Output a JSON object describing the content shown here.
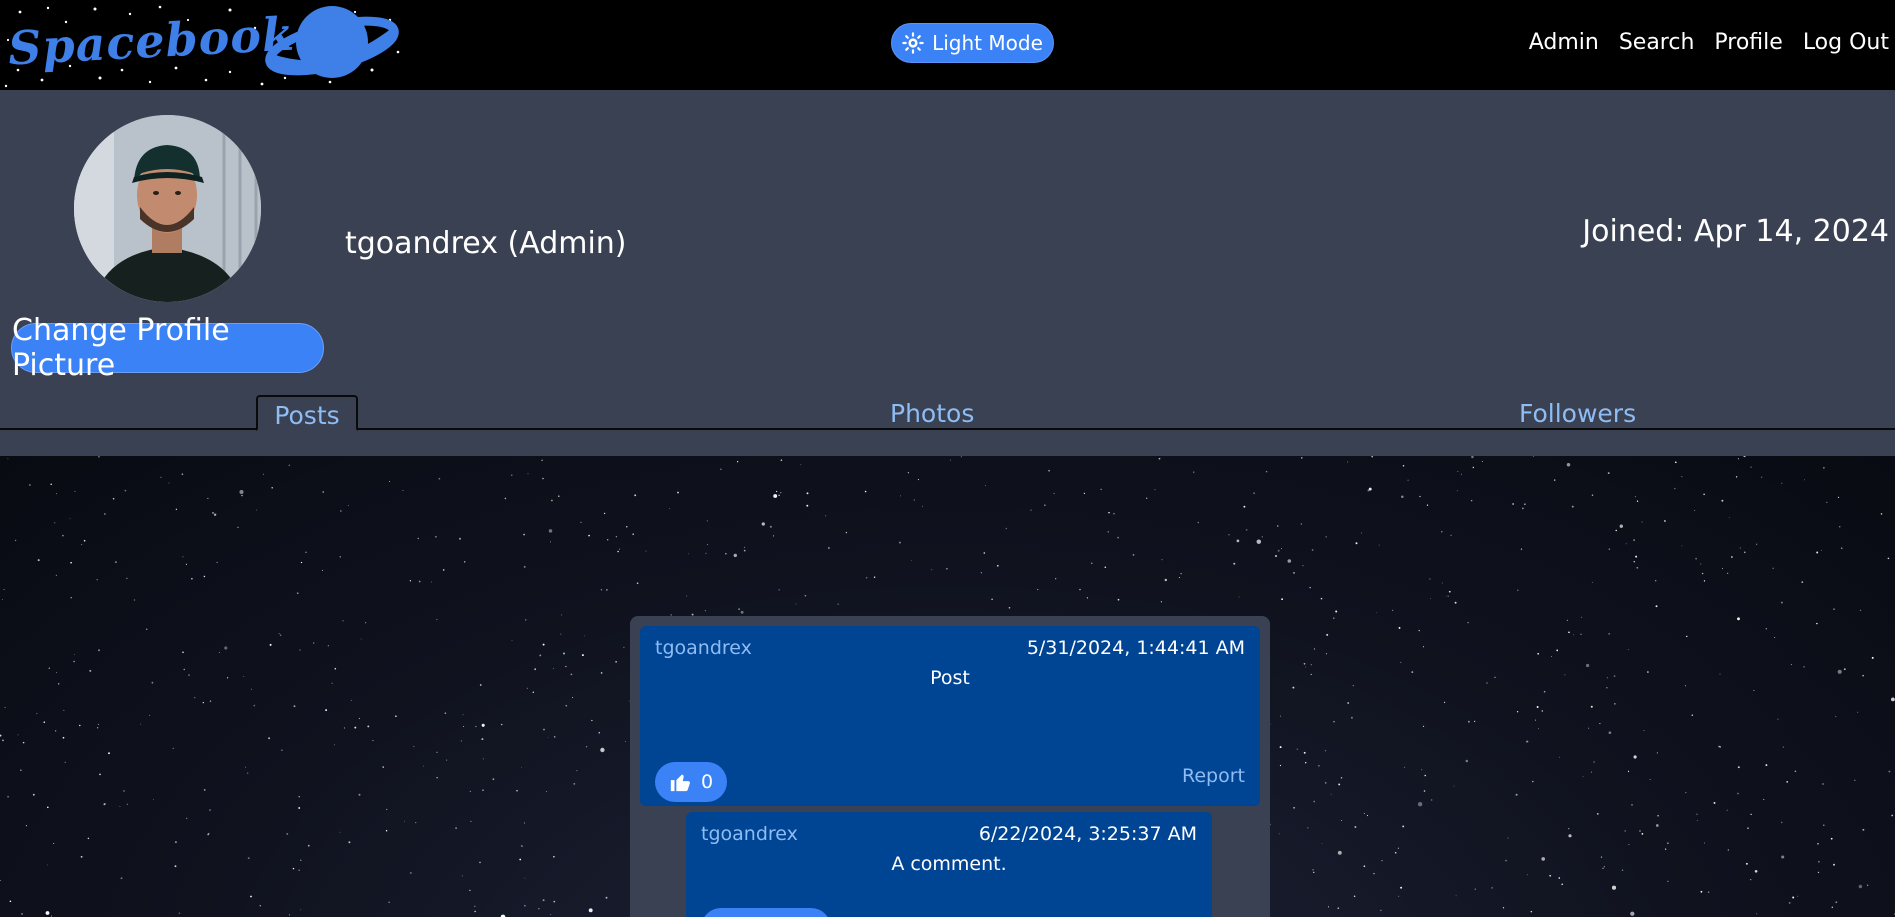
{
  "app": {
    "logo_text": "Spacebook",
    "theme_toggle_label": "Light Mode",
    "icons": {
      "theme": "sun-icon",
      "like": "thumbs-up-icon",
      "logo": "planet-icon"
    },
    "colors": {
      "accent": "#3b82f6",
      "link": "#8ebcf3",
      "post_bg": "#004494",
      "panel_bg": "#3a4152"
    }
  },
  "nav": {
    "items": [
      {
        "label": "Admin"
      },
      {
        "label": "Search"
      },
      {
        "label": "Profile"
      },
      {
        "label": "Log Out"
      }
    ]
  },
  "profile": {
    "username_display": "tgoandrex (Admin)",
    "joined_text": "Joined: Apr 14, 2024",
    "change_picture_label": "Change Profile Picture"
  },
  "tabs": [
    {
      "label": "Posts",
      "active": true
    },
    {
      "label": "Photos",
      "active": false
    },
    {
      "label": "Followers",
      "active": false
    }
  ],
  "posts": [
    {
      "author": "tgoandrex",
      "timestamp": "5/31/2024, 1:44:41 AM",
      "body": "Post",
      "likes": "0",
      "report_label": "Report",
      "comments": [
        {
          "author": "tgoandrex",
          "timestamp": "6/22/2024, 3:25:37 AM",
          "body": "A comment."
        }
      ]
    }
  ]
}
